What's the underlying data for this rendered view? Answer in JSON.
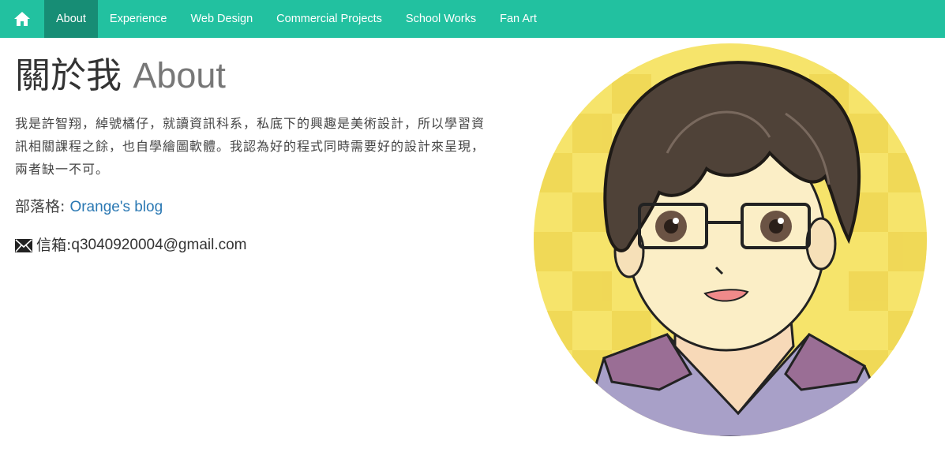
{
  "nav": {
    "home_icon": "home-icon",
    "items": [
      {
        "label": "About",
        "active": true
      },
      {
        "label": "Experience",
        "active": false
      },
      {
        "label": "Web Design",
        "active": false
      },
      {
        "label": "Commercial Projects",
        "active": false
      },
      {
        "label": "School Works",
        "active": false
      },
      {
        "label": "Fan Art",
        "active": false
      }
    ]
  },
  "about": {
    "title_zh": "關於我",
    "title_en": "About",
    "bio": "我是許智翔，綽號橘仔，就讀資訊科系，私底下的興趣是美術設計，所以學習資訊相關課程之餘，也自學繪圖軟體。我認為好的程式同時需要好的設計來呈現，兩者缺一不可。",
    "blog_label": "部落格: ",
    "blog_link": "Orange's blog",
    "mail_icon": "envelope-icon",
    "mail_label": "信箱:",
    "email": "q3040920004@gmail.com"
  },
  "colors": {
    "navbar": "#22c1a0",
    "navbar_active": "#178d75",
    "link": "#2a78b3",
    "avatar_bg": "#f7e46a"
  }
}
